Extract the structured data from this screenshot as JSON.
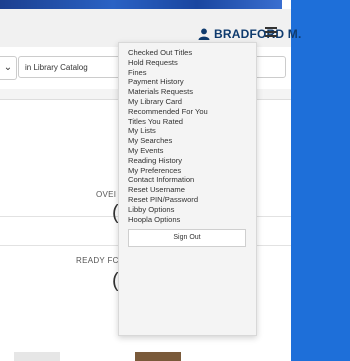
{
  "header": {
    "user_name": "BRADFORD M.",
    "user_icon": "person-icon",
    "menu_icon": "hamburger-icon"
  },
  "search": {
    "scope": "in Library Catalog"
  },
  "account_summary": {
    "overdue_label": "OVEI",
    "overdue_value": "(",
    "ready_label": "READY FC",
    "ready_value": "("
  },
  "account_menu": {
    "items": [
      "Checked Out Titles",
      "Hold Requests",
      "Fines",
      "Payment History",
      "Materials Requests",
      "My Library Card",
      "Recommended For You",
      "Titles You Rated",
      "My Lists",
      "My Searches",
      "My Events",
      "Reading History",
      "My Preferences",
      "Contact Information",
      "Reset Username",
      "Reset PIN/Password",
      "Libby Options",
      "Hoopla Options"
    ],
    "sign_out": "Sign Out"
  },
  "colors": {
    "brand_blue": "#1e6fd9",
    "user_name": "#0f3b6e"
  }
}
